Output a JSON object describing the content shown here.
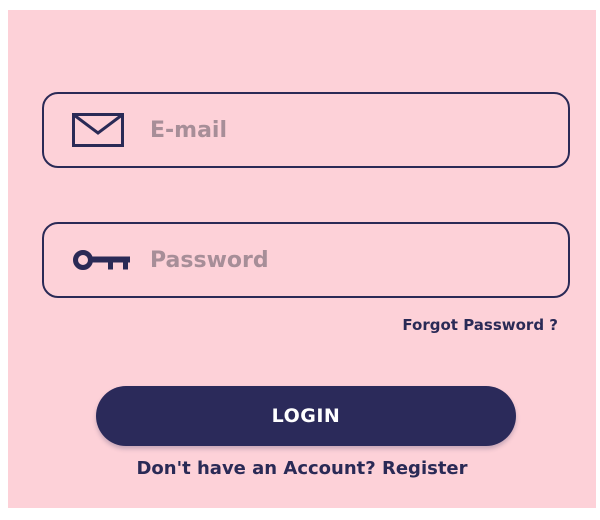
{
  "form": {
    "email": {
      "placeholder": "E-mail",
      "value": "",
      "icon": "envelope-icon"
    },
    "password": {
      "placeholder": "Password",
      "value": "",
      "icon": "key-icon"
    },
    "forgot_label": "Forgot Password ?",
    "login_label": "LOGIN",
    "account_prompt": "Don't have an Account?",
    "register_label": "Register"
  },
  "colors": {
    "background": "#fdd1d8",
    "accent": "#2b2a5a",
    "placeholder": "#a78e98",
    "button_text": "#ffffff"
  }
}
